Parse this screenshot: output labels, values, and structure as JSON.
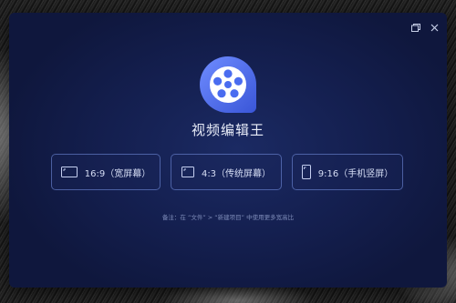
{
  "window": {
    "app_name": "视频编辑王",
    "controls": [
      "restore-icon",
      "close-icon"
    ]
  },
  "ratio_options": [
    {
      "label": "16:9（宽屏幕）",
      "icon": "widescreen-icon"
    },
    {
      "label": "4:3（传统屏幕）",
      "icon": "standard-screen-icon"
    },
    {
      "label": "9:16（手机竖屏）",
      "icon": "phone-portrait-icon"
    }
  ],
  "hint": "备注：在 “文件” > “新建项目” 中使用更多宽高比",
  "colors": {
    "window_bg": "#141f4f",
    "logo_blue": "#4a6cf0",
    "border": "#7896e6"
  }
}
